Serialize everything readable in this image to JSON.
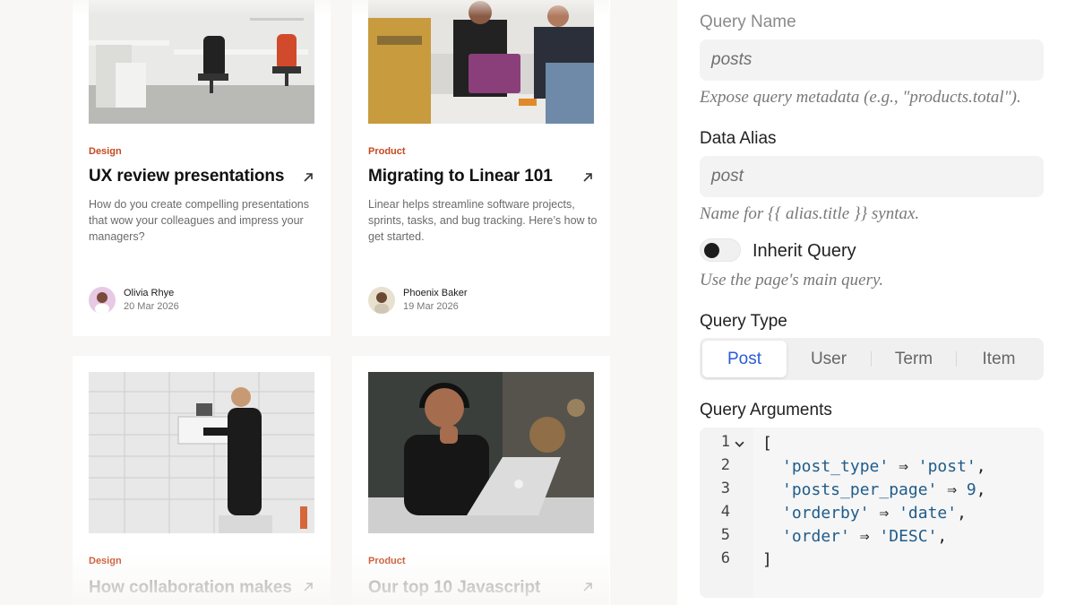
{
  "cards": [
    {
      "category": "Design",
      "title": "UX review presentations",
      "description": "How do you create compelling presentations that wow your colleagues and impress your managers?",
      "author": "Olivia Rhye",
      "date": "20 Mar 2026"
    },
    {
      "category": "Product",
      "title": "Migrating to Linear 101",
      "description": "Linear helps streamline software projects, sprints, tasks, and bug tracking. Here’s how to get started.",
      "author": "Phoenix Baker",
      "date": "19 Mar 2026"
    },
    {
      "category": "Design",
      "title": "How collaboration makes"
    },
    {
      "category": "Product",
      "title": "Our top 10 Javascript"
    }
  ],
  "panel": {
    "query_name_label": "Query Name",
    "query_name_value": "posts",
    "query_name_help": "Expose query metadata (e.g., \"products.total\").",
    "data_alias_label": "Data Alias",
    "data_alias_value": "post",
    "data_alias_help": "Name for {{ alias.title }} syntax.",
    "inherit_label": "Inherit Query",
    "inherit_on": false,
    "inherit_help": "Use the page's main query.",
    "query_type_label": "Query Type",
    "query_type_tabs": [
      "Post",
      "User",
      "Term",
      "Item"
    ],
    "query_type_selected": "Post",
    "query_args_label": "Query Arguments",
    "code_lines": [
      "1",
      "2",
      "3",
      "4",
      "5",
      "6"
    ],
    "code": {
      "open": "[",
      "k1": "'post_type'",
      "v1": "'post'",
      "k2": "'posts_per_page'",
      "v2": "9",
      "k3": "'orderby'",
      "v3": "'date'",
      "k4": "'order'",
      "v4": "'DESC'",
      "arrow": "⇒",
      "comma": ",",
      "close": "]"
    }
  },
  "colors": {
    "accent_category": "#c4491f",
    "active_tab": "#2a5bd7",
    "code_string": "#1f5c8a"
  }
}
